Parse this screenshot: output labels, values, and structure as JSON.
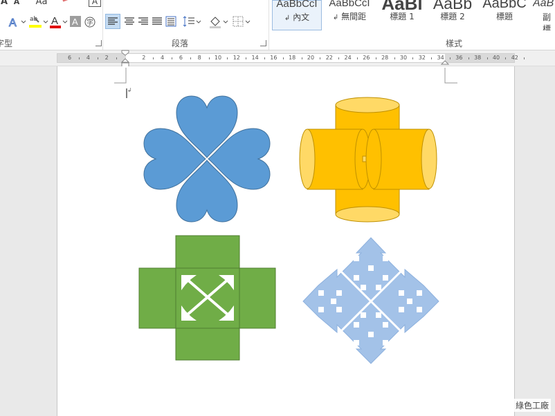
{
  "ribbon": {
    "font_group_label": "字型",
    "paragraph_group_label": "段落",
    "styles_group_label": "樣式",
    "styles": [
      {
        "preview": "AaBbCcI",
        "name": "內文",
        "selected": true
      },
      {
        "preview": "AaBbCcI",
        "name": "無間距",
        "selected": false
      },
      {
        "preview": "AaBl",
        "name": "標題 1",
        "selected": false
      },
      {
        "preview": "AaBb",
        "name": "標題 2",
        "selected": false
      },
      {
        "preview": "AaBbC",
        "name": "標題",
        "selected": false
      },
      {
        "preview": "AaB",
        "name": "副標",
        "selected": false
      }
    ],
    "top_labels": {
      "font_a": "A",
      "font_b": "A",
      "aa": "Aa",
      "format": "A"
    },
    "icons": [
      "text-effects-icon",
      "highlight-icon",
      "font-color-icon",
      "char-shading-icon",
      "enclose-char-icon",
      "align-left-icon",
      "align-center-icon",
      "align-right-icon",
      "justify-icon",
      "distributed-icon",
      "line-spacing-icon",
      "shading-icon",
      "borders-icon"
    ]
  },
  "ruler": {
    "labels": [
      "6",
      "4",
      "2",
      "2",
      "4",
      "6",
      "8",
      "10",
      "12",
      "14",
      "16",
      "18",
      "20",
      "22",
      "24",
      "26",
      "28",
      "30",
      "32",
      "34",
      "36",
      "38",
      "40",
      "42"
    ]
  },
  "document": {
    "shapes": [
      "heart-clover-shape",
      "cylinder-cross-shape",
      "green-cross-arrow-shape",
      "blue-diamond-arrows-shape"
    ]
  },
  "colors": {
    "heart_fill": "#5b9bd5",
    "cylinder_fill": "#ffc000",
    "cylinder_cap": "#ffd966",
    "green_fill": "#70ad47",
    "diamond_fill": "#a3c2e8"
  },
  "watermark": "綠色工廠"
}
